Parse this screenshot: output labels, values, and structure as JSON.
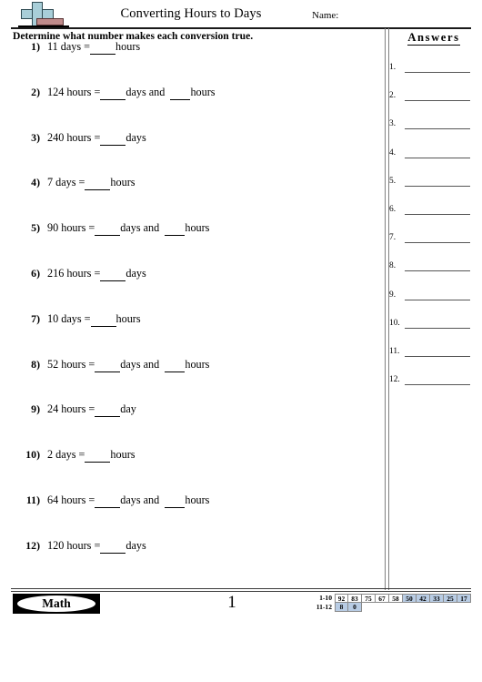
{
  "header": {
    "title": "Converting Hours to Days",
    "name_label": "Name:",
    "logo_icon": "plus-minus-icon"
  },
  "instruction": "Determine what number makes each conversion true.",
  "questions": [
    {
      "num": "1)",
      "pre": "11 days =",
      "unit1": "hours",
      "conj": "",
      "unit2": ""
    },
    {
      "num": "2)",
      "pre": "124 hours =",
      "unit1": "days",
      "conj": "and",
      "unit2": "hours"
    },
    {
      "num": "3)",
      "pre": "240 hours =",
      "unit1": "days",
      "conj": "",
      "unit2": ""
    },
    {
      "num": "4)",
      "pre": "7 days =",
      "unit1": "hours",
      "conj": "",
      "unit2": ""
    },
    {
      "num": "5)",
      "pre": "90 hours =",
      "unit1": "days",
      "conj": "and",
      "unit2": "hours"
    },
    {
      "num": "6)",
      "pre": "216 hours =",
      "unit1": "days",
      "conj": "",
      "unit2": ""
    },
    {
      "num": "7)",
      "pre": "10 days =",
      "unit1": "hours",
      "conj": "",
      "unit2": ""
    },
    {
      "num": "8)",
      "pre": "52 hours =",
      "unit1": "days",
      "conj": "and",
      "unit2": "hours"
    },
    {
      "num": "9)",
      "pre": "24 hours =",
      "unit1": "day",
      "conj": "",
      "unit2": ""
    },
    {
      "num": "10)",
      "pre": "2 days =",
      "unit1": "hours",
      "conj": "",
      "unit2": ""
    },
    {
      "num": "11)",
      "pre": "64 hours =",
      "unit1": "days",
      "conj": "and",
      "unit2": "hours"
    },
    {
      "num": "12)",
      "pre": "120 hours =",
      "unit1": "days",
      "conj": "",
      "unit2": ""
    }
  ],
  "answers": {
    "heading": "Answers",
    "items": [
      {
        "num": "1.",
        "value": ""
      },
      {
        "num": "2.",
        "value": ""
      },
      {
        "num": "3.",
        "value": ""
      },
      {
        "num": "4.",
        "value": ""
      },
      {
        "num": "5.",
        "value": ""
      },
      {
        "num": "6.",
        "value": ""
      },
      {
        "num": "7.",
        "value": ""
      },
      {
        "num": "8.",
        "value": ""
      },
      {
        "num": "9.",
        "value": ""
      },
      {
        "num": "10.",
        "value": ""
      },
      {
        "num": "11.",
        "value": ""
      },
      {
        "num": "12.",
        "value": ""
      }
    ]
  },
  "footer": {
    "badge_label": "Math",
    "page_number": "1",
    "score_grid": {
      "rows": [
        {
          "label": "1-10",
          "cells": [
            {
              "value": "92",
              "highlight": false
            },
            {
              "value": "83",
              "highlight": false
            },
            {
              "value": "75",
              "highlight": false
            },
            {
              "value": "67",
              "highlight": false
            },
            {
              "value": "58",
              "highlight": false
            },
            {
              "value": "50",
              "highlight": true
            },
            {
              "value": "42",
              "highlight": true
            },
            {
              "value": "33",
              "highlight": true
            },
            {
              "value": "25",
              "highlight": true
            },
            {
              "value": "17",
              "highlight": true
            }
          ]
        },
        {
          "label": "11-12",
          "cells": [
            {
              "value": "8",
              "highlight": true
            },
            {
              "value": "0",
              "highlight": true
            }
          ]
        }
      ],
      "highlight_color": "#b8cce4"
    }
  }
}
